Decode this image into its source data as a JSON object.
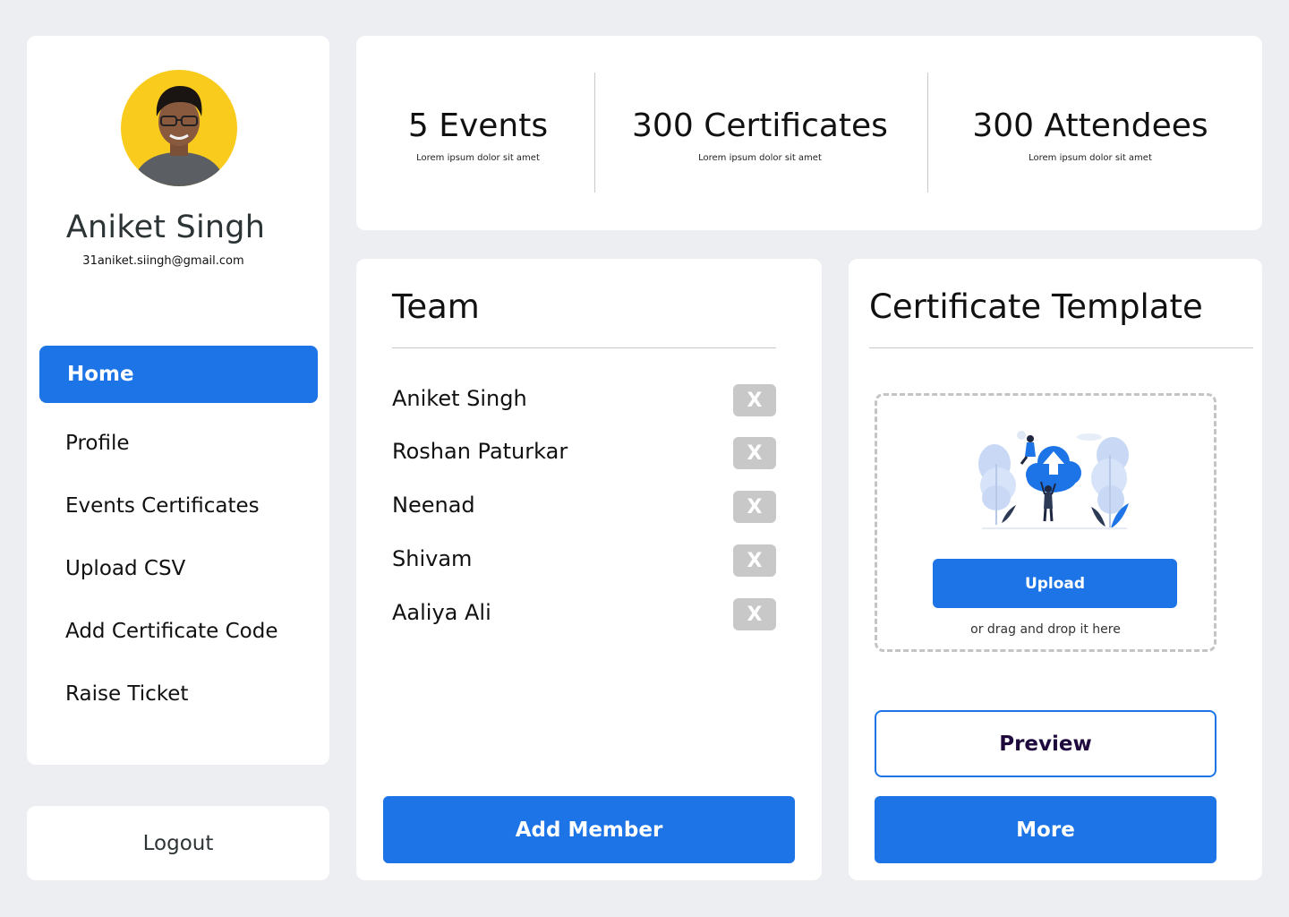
{
  "profile": {
    "name": "Aniket Singh",
    "email": "31aniket.siingh@gmail.com",
    "avatar_bg": "#F8CB1C"
  },
  "sidebar": {
    "items": [
      {
        "label": "Home",
        "active": true
      },
      {
        "label": "Profile",
        "active": false
      },
      {
        "label": "Events Certificates",
        "active": false
      },
      {
        "label": "Upload CSV",
        "active": false
      },
      {
        "label": "Add Certificate Code",
        "active": false
      },
      {
        "label": "Raise Ticket",
        "active": false
      }
    ],
    "logout_label": "Logout"
  },
  "stats": [
    {
      "value": "5 Events",
      "desc": "Lorem ipsum dolor sit amet"
    },
    {
      "value": "300 Certificates",
      "desc": "Lorem ipsum dolor sit amet"
    },
    {
      "value": "300 Attendees",
      "desc": "Lorem ipsum dolor sit amet"
    }
  ],
  "team": {
    "title": "Team",
    "members": [
      "Aniket Singh",
      "Roshan Paturkar",
      "Neenad",
      "Shivam",
      "Aaliya Ali"
    ],
    "remove_label": "X",
    "add_label": "Add Member"
  },
  "template": {
    "title": "Certificate Template",
    "upload_label": "Upload",
    "drop_hint": "or drag and drop it here",
    "preview_label": "Preview",
    "more_label": "More"
  },
  "colors": {
    "accent": "#1D74E7",
    "page_bg": "#ECEEF1",
    "remove_button": "#C8C8C8"
  }
}
